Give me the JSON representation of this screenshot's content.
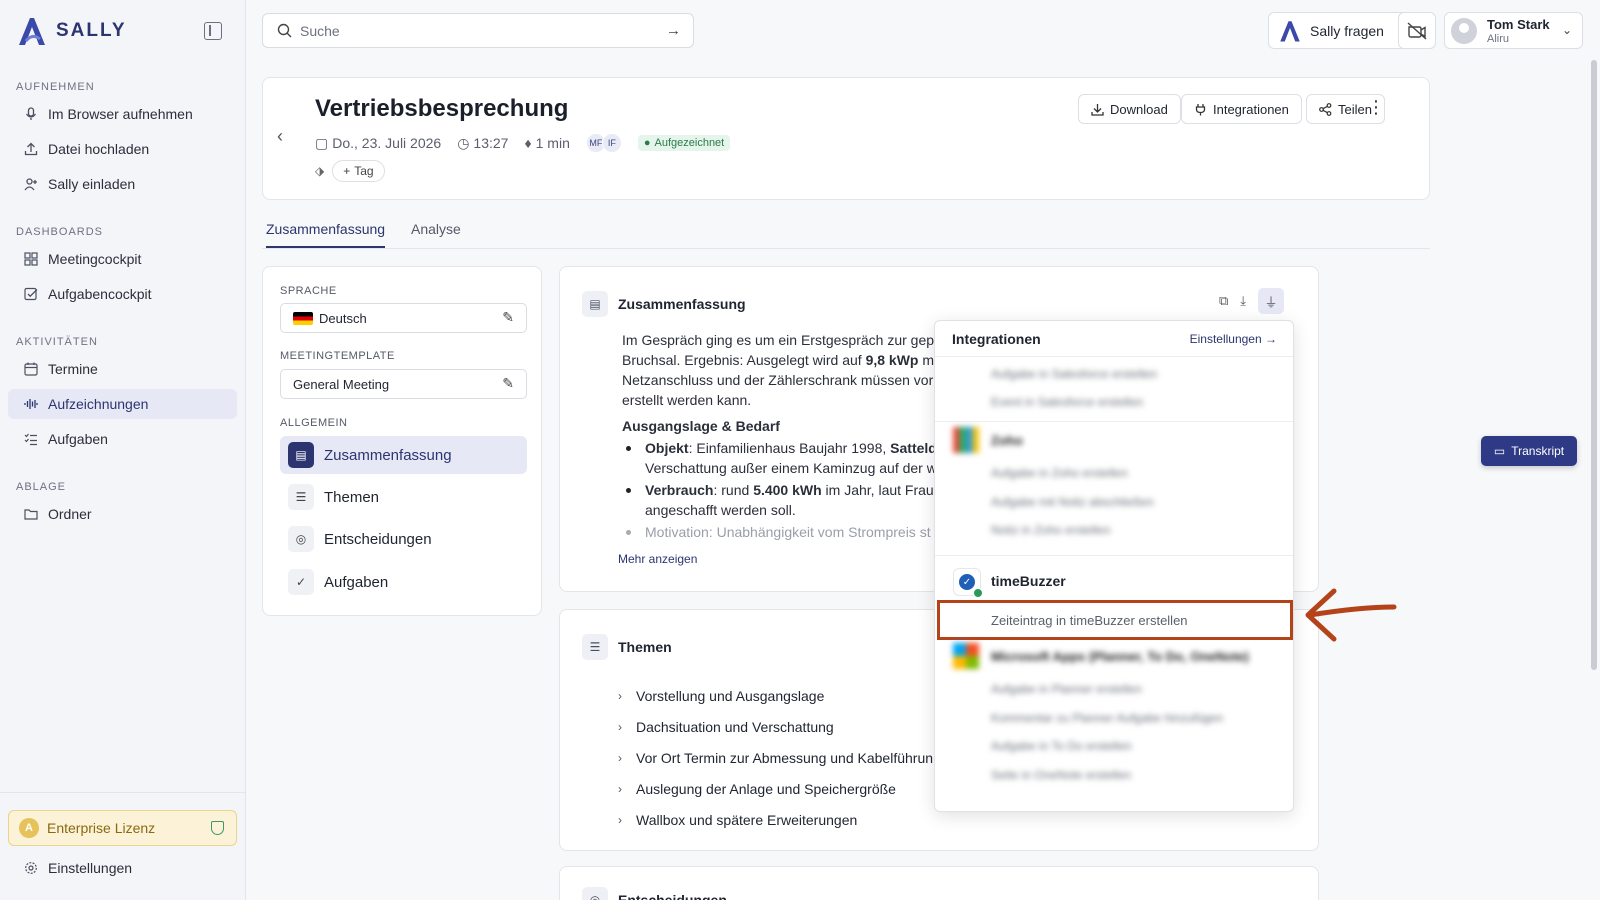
{
  "app": {
    "name": "SALLY"
  },
  "sidebar": {
    "sections": [
      {
        "label": "AUFNEHMEN",
        "items": [
          {
            "label": "Im Browser aufnehmen",
            "icon": "mic-icon"
          },
          {
            "label": "Datei hochladen",
            "icon": "upload-icon"
          },
          {
            "label": "Sally einladen",
            "icon": "user-plus-icon"
          }
        ]
      },
      {
        "label": "DASHBOARDS",
        "items": [
          {
            "label": "Meetingcockpit",
            "icon": "grid-icon"
          },
          {
            "label": "Aufgabencockpit",
            "icon": "checkbox-icon"
          }
        ]
      },
      {
        "label": "AKTIVITÄTEN",
        "items": [
          {
            "label": "Termine",
            "icon": "calendar-icon"
          },
          {
            "label": "Aufzeichnungen",
            "icon": "waveform-icon",
            "active": true
          },
          {
            "label": "Aufgaben",
            "icon": "list-check-icon"
          }
        ]
      },
      {
        "label": "ABLAGE",
        "items": [
          {
            "label": "Ordner",
            "icon": "folder-icon"
          }
        ]
      }
    ],
    "license": "Enterprise Lizenz",
    "settings": "Einstellungen"
  },
  "topbar": {
    "search_placeholder": "Suche",
    "ask_label": "Sally fragen",
    "user_name": "Tom Stark",
    "user_org": "Aliru"
  },
  "meeting": {
    "title": "Vertriebsbesprechung",
    "date": "Do., 23. Juli 2026",
    "time": "13:27",
    "duration": "1 min",
    "participants": [
      "MF",
      "IF"
    ],
    "status": "Aufgezeichnet",
    "tag_label": "Tag",
    "actions": {
      "download": "Download",
      "integrations": "Integrationen",
      "share": "Teilen"
    }
  },
  "tabs": [
    "Zusammenfassung",
    "Analyse"
  ],
  "left_panel": {
    "language_label": "SPRACHE",
    "language_value": "Deutsch",
    "template_label": "MEETINGTEMPLATE",
    "template_value": "General Meeting",
    "general_label": "ALLGEMEIN",
    "items": [
      "Zusammenfassung",
      "Themen",
      "Entscheidungen",
      "Aufgaben"
    ]
  },
  "summary": {
    "title": "Zusammenfassung",
    "line1": "Im Gespräch ging es um ein Erstgespräch zur gepla",
    "line2_a": "Bruchsal. Ergebnis: Ausgelegt wird auf ",
    "line2_b": "9,8 kWp",
    "line2_c": " mit",
    "line3": "Netzanschluss und der Zählerschrank müssen vor (",
    "line4": "erstellt werden kann.",
    "section": "Ausgangslage & Bedarf",
    "b1_label": "Objekt",
    "b1_text": ": Einfamilienhaus Baujahr 1998, ",
    "b1_bold": "Satteldac",
    "b1_line2": "Verschattung außer einem Kaminzug auf der we",
    "b2_label": "Verbrauch",
    "b2_text": ": rund ",
    "b2_bold": "5.400 kWh",
    "b2_text2": " im Jahr, laut Frau Br",
    "b2_line2": "angeschafft werden soll.",
    "b3_label": "Motivation",
    "b3_text": ": Unabhängigkeit vom Strompreis st",
    "more": "Mehr anzeigen"
  },
  "themes": {
    "title": "Themen",
    "items": [
      "Vorstellung und Ausgangslage",
      "Dachsituation und Verschattung",
      "Vor Ort Termin zur Abmessung und Kabelführun",
      "Auslegung der Anlage und Speichergröße",
      "Wallbox und spätere Erweiterungen"
    ]
  },
  "decisions": {
    "title": "Entscheidungen"
  },
  "transkript": "Transkript",
  "integrations": {
    "title": "Integrationen",
    "settings": "Einstellungen",
    "blurred_top": [
      "Aufgabe in Salesforce erstellen",
      "Event in Salesforce erstellen"
    ],
    "zoho": {
      "name": "Zoho",
      "actions": [
        "Aufgabe in Zoho erstellen",
        "Aufgabe mit Notiz abschließen",
        "Notiz in Zoho erstellen"
      ]
    },
    "timebuzzer": {
      "name": "timeBuzzer",
      "action": "Zeiteintrag in timeBuzzer erstellen"
    },
    "microsoft": {
      "name": "Microsoft Apps (Planner, To Do, OneNote)",
      "actions": [
        "Aufgabe in Planner erstellen",
        "Kommentar zu Planner Aufgabe hinzufügen",
        "Aufgabe in To Do erstellen",
        "Seite in OneNote erstellen"
      ]
    }
  },
  "colors": {
    "primary": "#2c3570",
    "annotation": "#b5431a",
    "license_bg": "#fbf2d7"
  }
}
